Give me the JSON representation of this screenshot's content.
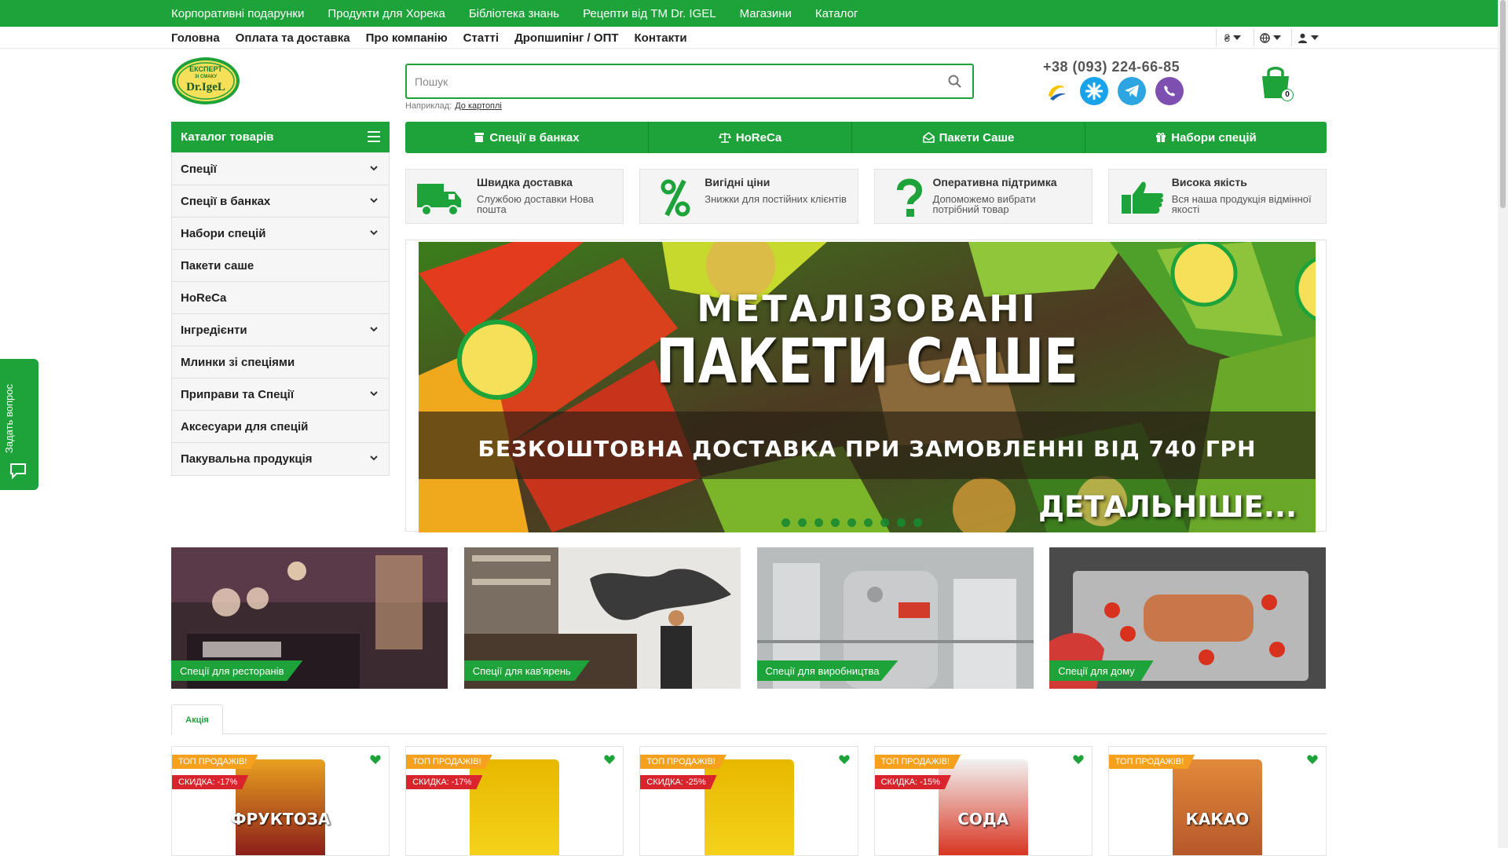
{
  "topbar": [
    "Корпоративні подарунки",
    "Продукти для Хорека",
    "Бібліотека знань",
    "Рецепти від ТМ Dr. IGEL",
    "Магазини",
    "Каталог"
  ],
  "nav": [
    "Головна",
    "Оплата та доставка",
    "Про компанію",
    "Статті",
    "Дропшипінг / ОПТ",
    "Контакти"
  ],
  "nav_right": {
    "currency": "₴",
    "language_icon": "globe-icon",
    "account_icon": "user-icon"
  },
  "logo": {
    "line1": "ЕКСПЕРТ",
    "line2": "ЗІ СМАКУ",
    "brand": "Dr.IgeL"
  },
  "search": {
    "placeholder": "Пошук",
    "example_label": "Наприклад:",
    "example_link": "До картоплі"
  },
  "contact": {
    "phone": "+38 (093) 224-66-85",
    "messengers": [
      "kyivstar-icon",
      "star-icon",
      "telegram-icon",
      "viber-icon"
    ]
  },
  "cart": {
    "count": "0"
  },
  "catalog": {
    "title": "Каталог товарів",
    "items": [
      {
        "label": "Спеції",
        "has_children": true
      },
      {
        "label": "Спеції в банках",
        "has_children": true
      },
      {
        "label": "Набори спецій",
        "has_children": true
      },
      {
        "label": "Пакети саше",
        "has_children": false
      },
      {
        "label": "HoReCa",
        "has_children": false
      },
      {
        "label": "Інгредієнти",
        "has_children": true
      },
      {
        "label": "Млинки зі спеціями",
        "has_children": false
      },
      {
        "label": "Приправи та Спеції",
        "has_children": true
      },
      {
        "label": "Аксесуари для спецій",
        "has_children": false
      },
      {
        "label": "Пакувальна продукція",
        "has_children": true
      }
    ]
  },
  "tabs": [
    "Спеції в банках",
    "HoReCa",
    "Пакети Саше",
    "Набори спецій"
  ],
  "features": [
    {
      "title": "Швидка доставка",
      "desc": "Службою доставки Нова пошта",
      "icon": "truck-icon"
    },
    {
      "title": "Вигідні ціни",
      "desc": "Знижки для постійних клієнтів",
      "icon": "percent-icon"
    },
    {
      "title": "Оперативна підтримка",
      "desc": "Допоможемо вибрати потрібний товар",
      "icon": "question-icon"
    },
    {
      "title": "Висока якість",
      "desc": "Вся наша продукція відмінної якості",
      "icon": "thumbs-up-icon"
    }
  ],
  "banner": {
    "line1": "МЕТАЛІЗОВАНІ",
    "line2": "ПАКЕТИ САШЕ",
    "line3": "БЕЗКОШТОВНА ДОСТАВКА ПРИ ЗАМОВЛЕННІ ВІД 740 ГРН",
    "more": "ДЕТАЛЬНІШЕ...",
    "slides": 9
  },
  "segments": [
    "Спеції для ресторанів",
    "Спеції для кав'ярень",
    "Спеції для виробництва",
    "Спеції для дому"
  ],
  "promo": {
    "tab": "Акція"
  },
  "products": [
    {
      "badge": "ТОП ПРОДАЖІВ!",
      "discount": "СКИДКА: -17%",
      "name": "ФРУКТОЗА"
    },
    {
      "badge": "ТОП ПРОДАЖІВ!",
      "discount": "СКИДКА: -17%",
      "name": ""
    },
    {
      "badge": "ТОП ПРОДАЖІВ!",
      "discount": "СКИДКА: -25%",
      "name": ""
    },
    {
      "badge": "ТОП ПРОДАЖІВ!",
      "discount": "СКИДКА: -15%",
      "name": "СОДА"
    },
    {
      "badge": "ТОП ПРОДАЖІВ!",
      "discount": "",
      "name": "КАКАО"
    }
  ],
  "side_widget": {
    "label": "Задать вопрос"
  },
  "colors": {
    "brand_green": "#1ea33a",
    "badge_orange": "#f5a11d",
    "discount_red": "#d9232d"
  }
}
